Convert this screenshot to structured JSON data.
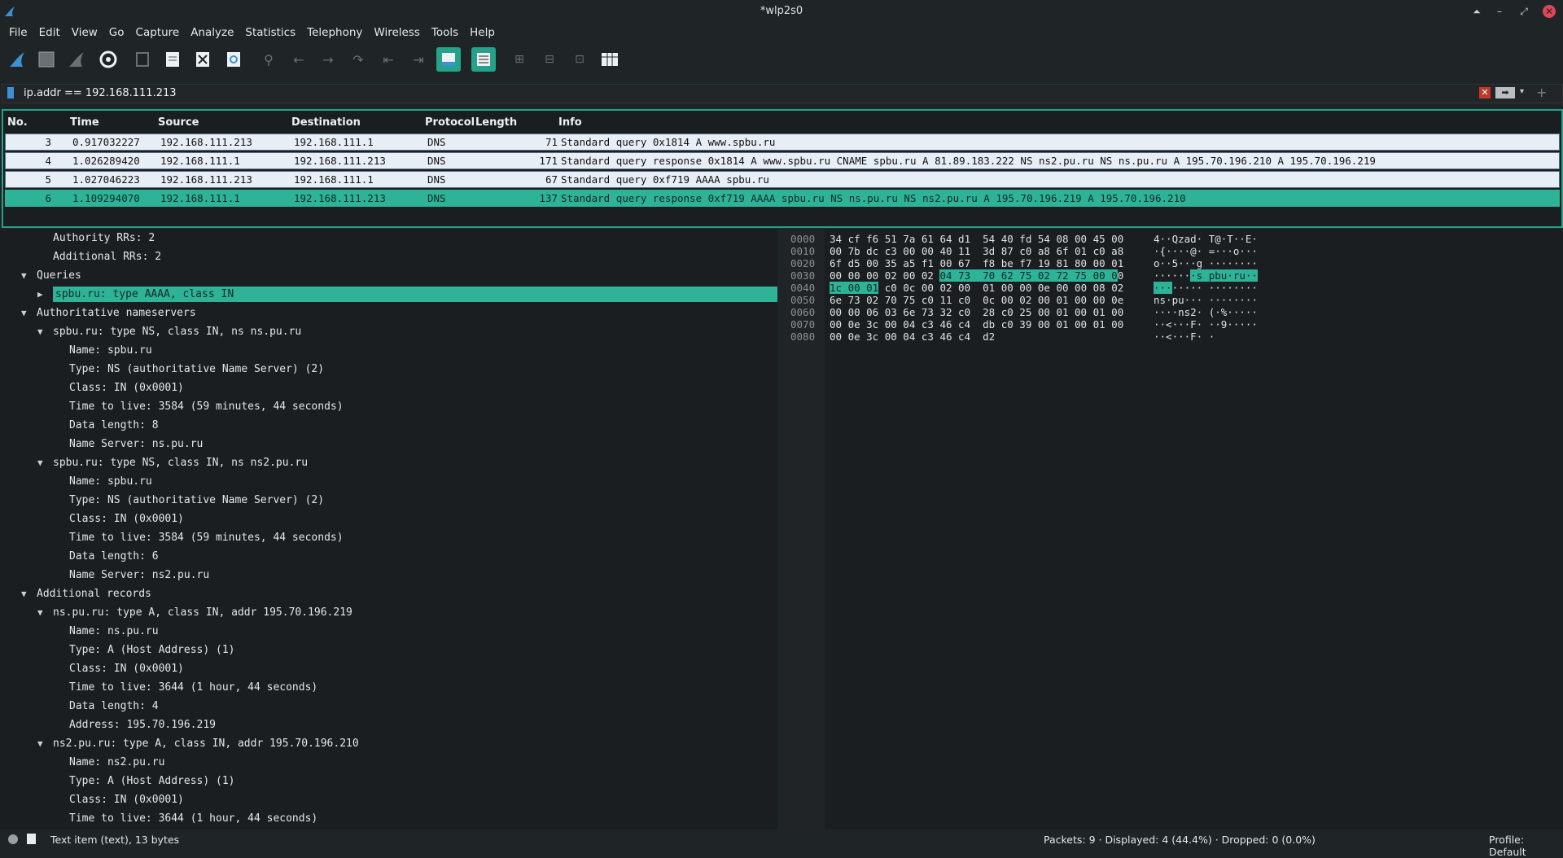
{
  "window": {
    "title": "*wlp2s0"
  },
  "menu": [
    "File",
    "Edit",
    "View",
    "Go",
    "Capture",
    "Analyze",
    "Statistics",
    "Telephony",
    "Wireless",
    "Tools",
    "Help"
  ],
  "filter": {
    "value": "ip.addr == 192.168.111.213"
  },
  "columns": [
    "No.",
    "Time",
    "Source",
    "Destination",
    "Protocol",
    "Length",
    "Info"
  ],
  "packets": [
    {
      "no": "3",
      "time": "0.917032227",
      "src": "192.168.111.213",
      "dst": "192.168.111.1",
      "proto": "DNS",
      "len": "71",
      "info": "Standard query 0x1814 A www.spbu.ru",
      "selected": false
    },
    {
      "no": "4",
      "time": "1.026289420",
      "src": "192.168.111.1",
      "dst": "192.168.111.213",
      "proto": "DNS",
      "len": "171",
      "info": "Standard query response 0x1814 A www.spbu.ru CNAME spbu.ru A 81.89.183.222 NS ns2.pu.ru NS ns.pu.ru A 195.70.196.210 A 195.70.196.219",
      "selected": false
    },
    {
      "no": "5",
      "time": "1.027046223",
      "src": "192.168.111.213",
      "dst": "192.168.111.1",
      "proto": "DNS",
      "len": "67",
      "info": "Standard query 0xf719 AAAA spbu.ru",
      "selected": false
    },
    {
      "no": "6",
      "time": "1.109294070",
      "src": "192.168.111.1",
      "dst": "192.168.111.213",
      "proto": "DNS",
      "len": "137",
      "info": "Standard query response 0xf719 AAAA spbu.ru NS ns.pu.ru NS ns2.pu.ru A 195.70.196.219 A 195.70.196.210",
      "selected": true
    }
  ],
  "details": [
    {
      "indent": 1,
      "arrow": "",
      "text": "Authority RRs: 2"
    },
    {
      "indent": 1,
      "arrow": "",
      "text": "Additional RRs: 2"
    },
    {
      "indent": 0,
      "arrow": "open",
      "text": "Queries"
    },
    {
      "indent": 1,
      "arrow": "closed",
      "text": "spbu.ru: type AAAA, class IN",
      "selected": true
    },
    {
      "indent": 0,
      "arrow": "open",
      "text": "Authoritative nameservers"
    },
    {
      "indent": 1,
      "arrow": "open",
      "text": "spbu.ru: type NS, class IN, ns ns.pu.ru"
    },
    {
      "indent": 2,
      "arrow": "",
      "text": "Name: spbu.ru"
    },
    {
      "indent": 2,
      "arrow": "",
      "text": "Type: NS (authoritative Name Server) (2)"
    },
    {
      "indent": 2,
      "arrow": "",
      "text": "Class: IN (0x0001)"
    },
    {
      "indent": 2,
      "arrow": "",
      "text": "Time to live: 3584 (59 minutes, 44 seconds)"
    },
    {
      "indent": 2,
      "arrow": "",
      "text": "Data length: 8"
    },
    {
      "indent": 2,
      "arrow": "",
      "text": "Name Server: ns.pu.ru"
    },
    {
      "indent": 1,
      "arrow": "open",
      "text": "spbu.ru: type NS, class IN, ns ns2.pu.ru"
    },
    {
      "indent": 2,
      "arrow": "",
      "text": "Name: spbu.ru"
    },
    {
      "indent": 2,
      "arrow": "",
      "text": "Type: NS (authoritative Name Server) (2)"
    },
    {
      "indent": 2,
      "arrow": "",
      "text": "Class: IN (0x0001)"
    },
    {
      "indent": 2,
      "arrow": "",
      "text": "Time to live: 3584 (59 minutes, 44 seconds)"
    },
    {
      "indent": 2,
      "arrow": "",
      "text": "Data length: 6"
    },
    {
      "indent": 2,
      "arrow": "",
      "text": "Name Server: ns2.pu.ru"
    },
    {
      "indent": 0,
      "arrow": "open",
      "text": "Additional records"
    },
    {
      "indent": 1,
      "arrow": "open",
      "text": "ns.pu.ru: type A, class IN, addr 195.70.196.219"
    },
    {
      "indent": 2,
      "arrow": "",
      "text": "Name: ns.pu.ru"
    },
    {
      "indent": 2,
      "arrow": "",
      "text": "Type: A (Host Address) (1)"
    },
    {
      "indent": 2,
      "arrow": "",
      "text": "Class: IN (0x0001)"
    },
    {
      "indent": 2,
      "arrow": "",
      "text": "Time to live: 3644 (1 hour, 44 seconds)"
    },
    {
      "indent": 2,
      "arrow": "",
      "text": "Data length: 4"
    },
    {
      "indent": 2,
      "arrow": "",
      "text": "Address: 195.70.196.219"
    },
    {
      "indent": 1,
      "arrow": "open",
      "text": "ns2.pu.ru: type A, class IN, addr 195.70.196.210"
    },
    {
      "indent": 2,
      "arrow": "",
      "text": "Name: ns2.pu.ru"
    },
    {
      "indent": 2,
      "arrow": "",
      "text": "Type: A (Host Address) (1)"
    },
    {
      "indent": 2,
      "arrow": "",
      "text": "Class: IN (0x0001)"
    },
    {
      "indent": 2,
      "arrow": "",
      "text": "Time to live: 3644 (1 hour, 44 seconds)"
    }
  ],
  "bytes": [
    {
      "off": "0000",
      "hex": "34 cf f6 51 7a 61 64 d1  54 40 fd 54 08 00 45 00",
      "ascii": "4··Qzad· T@·T··E·"
    },
    {
      "off": "0010",
      "hex": "00 7b dc c3 00 00 40 11  3d 87 c0 a8 6f 01 c0 a8",
      "ascii": "·{····@· =···o···"
    },
    {
      "off": "0020",
      "hex": "6f d5 00 35 a5 f1 00 67  f8 be f7 19 81 80 00 01",
      "ascii": "o··5···g ········"
    },
    {
      "off": "0030",
      "hex": "00 00 00 02 00 02 04 73  70 62 75 02 72 75 00 00",
      "ascii": "·······s pbu·ru··",
      "hl_hex": [
        18,
        47
      ],
      "hl_ascii": [
        6,
        17
      ]
    },
    {
      "off": "0040",
      "hex": "1c 00 01 c0 0c 00 02 00  01 00 00 0e 00 00 08 02",
      "ascii": "········ ········",
      "hl_hex": [
        0,
        8
      ],
      "hl_ascii": [
        0,
        3
      ]
    },
    {
      "off": "0050",
      "hex": "6e 73 02 70 75 c0 11 c0  0c 00 02 00 01 00 00 0e",
      "ascii": "ns·pu··· ········"
    },
    {
      "off": "0060",
      "hex": "00 00 06 03 6e 73 32 c0  28 c0 25 00 01 00 01 00",
      "ascii": "····ns2· (·%·····"
    },
    {
      "off": "0070",
      "hex": "00 0e 3c 00 04 c3 46 c4  db c0 39 00 01 00 01 00",
      "ascii": "··<···F· ··9·····"
    },
    {
      "off": "0080",
      "hex": "00 0e 3c 00 04 c3 46 c4  d2",
      "ascii": "··<···F· ·"
    }
  ],
  "status": {
    "left": "Text item (text), 13 bytes",
    "center": "Packets: 9 · Displayed: 4 (44.4%) · Dropped: 0 (0.0%)",
    "right": "Profile: Default"
  },
  "colors": {
    "accent": "#26a28a",
    "selected": "#2fb398",
    "row_bg": "#e8eef5",
    "bg": "#1b1e20"
  }
}
